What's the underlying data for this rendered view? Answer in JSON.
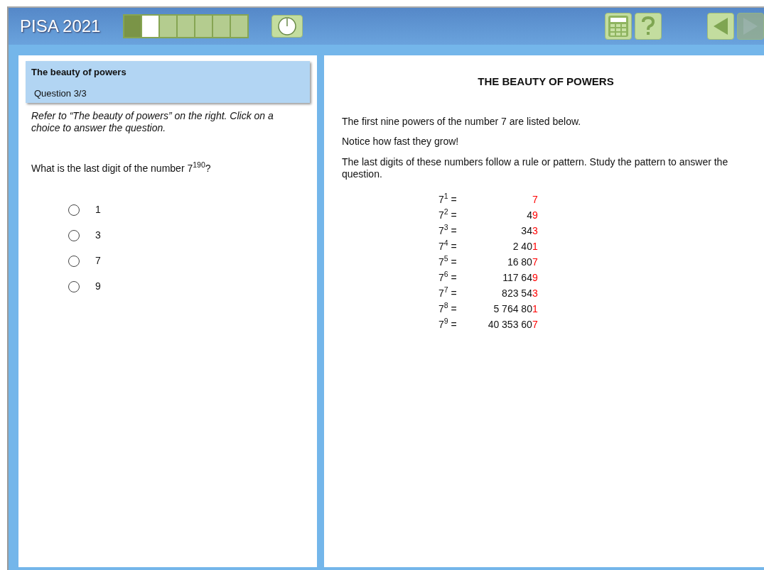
{
  "header": {
    "title": "PISA 2021",
    "progress": [
      {
        "completed": true,
        "current": false
      },
      {
        "completed": false,
        "current": true
      },
      {
        "completed": false,
        "current": false
      },
      {
        "completed": false,
        "current": false
      },
      {
        "completed": false,
        "current": false
      },
      {
        "completed": false,
        "current": false
      },
      {
        "completed": false,
        "current": false
      }
    ],
    "tools": [
      {
        "kind": "timer",
        "disabled": false
      },
      {
        "kind": "calculator",
        "disabled": false
      },
      {
        "kind": "help",
        "disabled": false
      }
    ],
    "navigation": [
      {
        "kind": "back",
        "disabled": false
      },
      {
        "kind": "next",
        "disabled": true
      }
    ]
  },
  "question_panel": {
    "unit_title": "The beauty of powers",
    "question_number": "Question 3/3",
    "instruction": "Refer to “The beauty of powers” on the right. Click on a choice to answer the question.",
    "question": "What is the last digit of the number 7$^{190}$?",
    "choices": [
      {
        "label": "1",
        "selected": false
      },
      {
        "label": "3",
        "selected": false
      },
      {
        "label": "7",
        "selected": false
      },
      {
        "label": "9",
        "selected": false
      }
    ]
  },
  "stimulus": {
    "title": "THE BEAUTY OF POWERS",
    "paragraphs": [
      "The first nine powers of the number 7 are listed below.",
      "Notice how fast they grow!",
      "The last digits of these numbers follow a rule or pattern. Study the pattern to answer the question."
    ],
    "powers": [
      {
        "expression": "7$^{1}$ =",
        "value": "7",
        "last_digit_highlighted": true
      },
      {
        "expression": "7$^{2}$ =",
        "value": "49",
        "last_digit_highlighted": true
      },
      {
        "expression": "7$^{3}$ =",
        "value": "343",
        "last_digit_highlighted": true
      },
      {
        "expression": "7$^{4}$ =",
        "value": "2 401",
        "last_digit_highlighted": true
      },
      {
        "expression": "7$^{5}$ =",
        "value": "16 807",
        "last_digit_highlighted": true
      },
      {
        "expression": "7$^{6}$ =",
        "value": "117 649",
        "last_digit_highlighted": true
      },
      {
        "expression": "7$^{7}$ =",
        "value": "823 543",
        "last_digit_highlighted": true
      },
      {
        "expression": "7$^{8}$ =",
        "value": "5 764 801",
        "last_digit_highlighted": true
      },
      {
        "expression": "7$^{9}$ =",
        "value": "40 353 607",
        "last_digit_highlighted": true
      }
    ]
  }
}
